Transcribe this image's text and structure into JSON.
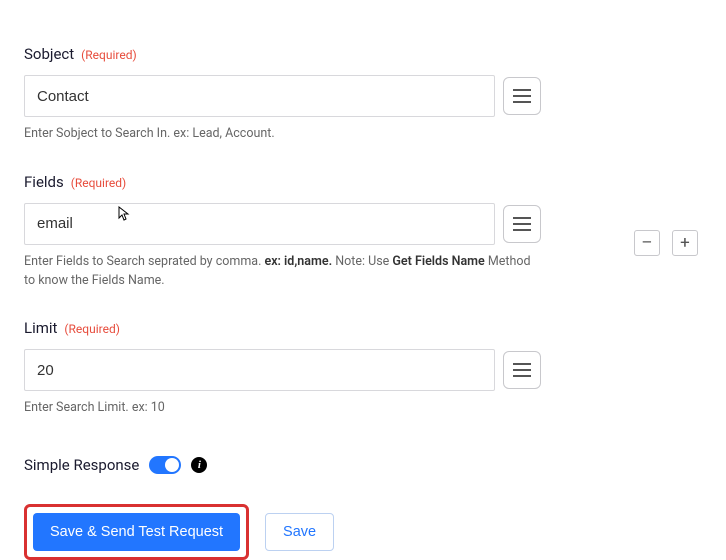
{
  "sobject": {
    "label": "Sobject",
    "required": "(Required)",
    "value": "Contact",
    "help": "Enter Sobject to Search In. ex: Lead, Account."
  },
  "fields": {
    "label": "Fields",
    "required": "(Required)",
    "value": "email",
    "help_pre": "Enter Fields to Search seprated by comma. ",
    "help_bold1": "ex: id,name.",
    "help_mid": " Note: Use ",
    "help_bold2": "Get Fields Name",
    "help_post": " Method to know the Fields Name."
  },
  "limit": {
    "label": "Limit",
    "required": "(Required)",
    "value": "20",
    "help": "Enter Search Limit. ex: 10"
  },
  "simple_response": {
    "label": "Simple Response",
    "enabled": true
  },
  "buttons": {
    "primary": "Save & Send Test Request",
    "secondary": "Save",
    "minus": "–",
    "plus": "+"
  }
}
